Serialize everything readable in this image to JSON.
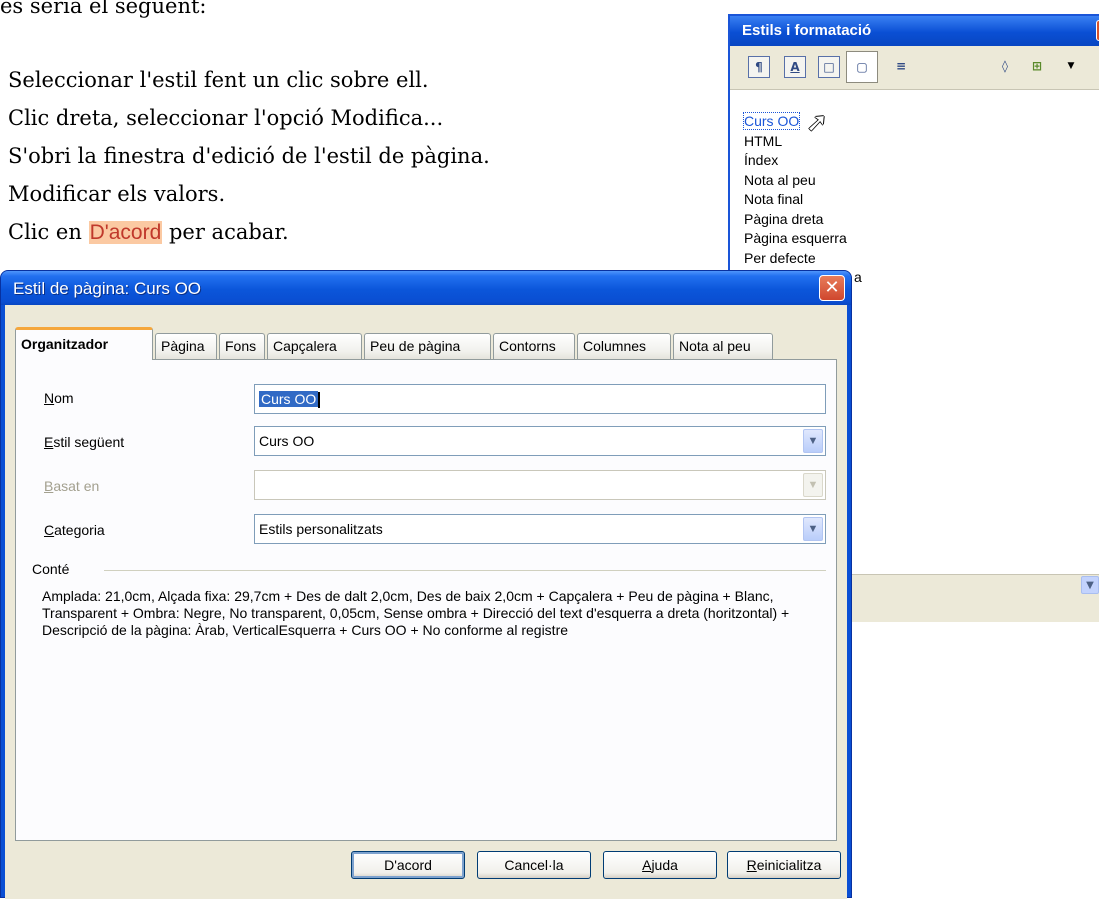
{
  "document": {
    "intro": "es seria el següent:",
    "steps": [
      "Seleccionar l'estil fent un clic sobre ell.",
      "Clic dreta, seleccionar l'opció Modifica...",
      "S'obri la finestra d'edició de l'estil de pàgina.",
      "Modificar els valors."
    ],
    "last_step_prefix": "Clic en ",
    "last_step_highlight": "D'acord",
    "last_step_suffix": " per acabar."
  },
  "styles_panel": {
    "title": "Estils i formatació",
    "close_glyph": "✕",
    "toolbar_icons": [
      "paragraph-styles-icon",
      "character-styles-icon",
      "frame-styles-icon",
      "page-styles-icon",
      "list-styles-icon",
      "fill-format-icon",
      "new-style-icon"
    ],
    "items": [
      "Curs OO",
      "HTML",
      "Índex",
      "Nota al peu",
      "Nota final",
      "Pàgina dreta",
      "Pàgina esquerra",
      "Per defecte",
      "a"
    ],
    "selected_item": "Curs OO"
  },
  "dialog": {
    "title": "Estil de pàgina: Curs OO",
    "close_glyph": "✕",
    "tabs": [
      "Organitzador",
      "Pàgina",
      "Fons",
      "Capçalera",
      "Peu de pàgina",
      "Contorns",
      "Columnes",
      "Nota al peu"
    ],
    "active_tab": "Organitzador",
    "fields": {
      "name": {
        "label_first": "N",
        "label_rest": "om",
        "value": "Curs OO"
      },
      "next_style": {
        "label_first": "E",
        "label_rest": "stil següent",
        "value": "Curs OO"
      },
      "linked_with": {
        "label_first": "B",
        "label_rest": "asat en",
        "value": ""
      },
      "category": {
        "label_first": "C",
        "label_rest": "ategoria",
        "value": "Estils personalitzats"
      }
    },
    "contains_label": "Conté",
    "contains_text": "Amplada: 21,0cm, Alçada fixa: 29,7cm + Des de dalt 2,0cm, Des de baix 2,0cm + Capçalera + Peu de pàgina + Blanc, Transparent + Ombra: Negre, No transparent, 0,05cm, Sense ombra + Direcció del text d'esquerra a dreta (horitzontal) + Descripció de la pàgina: Àrab, VerticalEsquerra + Curs OO + No conforme al registre",
    "buttons": {
      "ok": "D'acord",
      "cancel": "Cancel·la",
      "help_first": "A",
      "help_rest": "juda",
      "reset_first": "R",
      "reset_rest": "einicialitza"
    }
  },
  "colors": {
    "title_bar": "#0a4fd4",
    "dialog_face": "#ece9d8",
    "highlight": "#fbc9a2",
    "active_tab_accent": "#f5a73c"
  }
}
